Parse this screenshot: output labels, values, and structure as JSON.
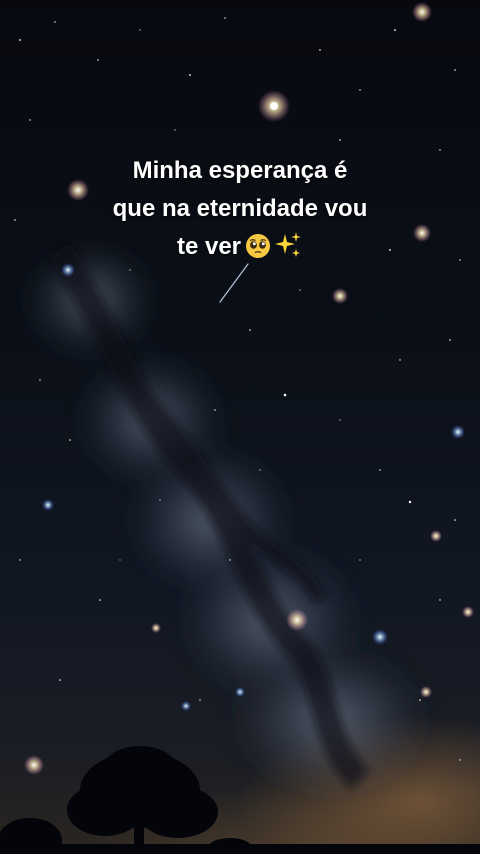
{
  "caption": {
    "line1": "Minha esperança é",
    "line2": "que na eternidade vou",
    "line3": "te ver",
    "emoji_face": "pleading-face-emoji",
    "emoji_sparkles": "sparkles-emoji"
  },
  "colors": {
    "text": "#ffffff",
    "sky_top": "#07090f",
    "horizon_glow": "#aa7846"
  }
}
